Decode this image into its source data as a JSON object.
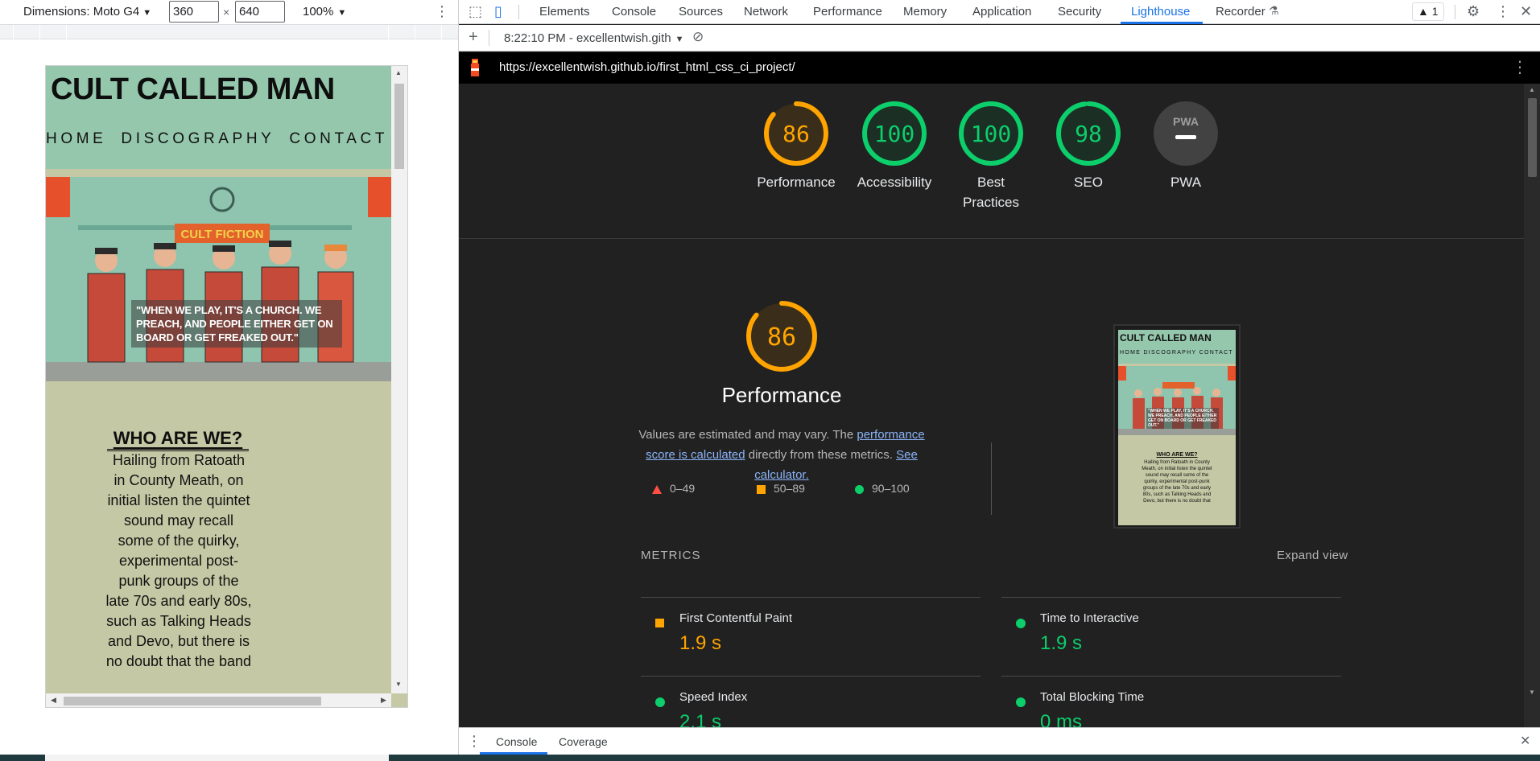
{
  "device_toolbar": {
    "dimensions_label": "Dimensions: Moto G4",
    "width_value": "360",
    "times": "×",
    "height_value": "640",
    "zoom_label": "100%"
  },
  "site": {
    "title": "CULT CALLED MAN",
    "nav": [
      "HOME",
      "DISCOGRAPHY",
      "CONTACT"
    ],
    "hero_quote": "\"WHEN WE PLAY, IT'S A CHURCH. WE PREACH, AND PEOPLE EITHER GET ON BOARD OR GET FREAKED OUT.\"",
    "hero_sign": "CULT FICTION",
    "about_heading": "WHO ARE WE?",
    "about_body": "Hailing from Ratoath in County Meath, on initial listen the quintet sound may recall some of the quirky, experimental post-punk groups of the late 70s and early 80s, such as Talking Heads and Devo, but there is no doubt that the band"
  },
  "devtools": {
    "tabs": [
      "Elements",
      "Console",
      "Sources",
      "Network",
      "Performance",
      "Memory",
      "Application",
      "Security",
      "Lighthouse",
      "Recorder"
    ],
    "active_tab": "Lighthouse",
    "warning_count": "1",
    "report_selector": "8:22:10 PM - excellentwish.gith",
    "url": "https://excellentwish.github.io/first_html_css_ci_project/",
    "drawer_tabs": [
      "Console",
      "Coverage"
    ]
  },
  "colors": {
    "orange": "#ffa400",
    "green": "#0cce6b",
    "red": "#ff4e42",
    "link_blue": "#8ab4f8",
    "devtools_active": "#1a73e8"
  },
  "report": {
    "gauges": [
      {
        "label": "Performance",
        "score": 86,
        "color": "orange"
      },
      {
        "label": "Accessibility",
        "score": 100,
        "color": "green"
      },
      {
        "label": "Best Practices",
        "score": 100,
        "color": "green"
      },
      {
        "label": "SEO",
        "score": 98,
        "color": "green"
      },
      {
        "label": "PWA",
        "score": null,
        "color": "gray"
      }
    ],
    "pwa_badge": "PWA",
    "performance_score": "86",
    "performance_title": "Performance",
    "desc_prefix": "Values are estimated and may vary. The ",
    "desc_link1": "performance score is calculated",
    "desc_middle": " directly from these metrics. ",
    "desc_link2": "See calculator.",
    "legend": [
      "0–49",
      "50–89",
      "90–100"
    ],
    "metrics_label": "METRICS",
    "expand_label": "Expand view",
    "metrics": [
      {
        "name": "First Contentful Paint",
        "value": "1.9 s",
        "rating": "orange"
      },
      {
        "name": "Time to Interactive",
        "value": "1.9 s",
        "rating": "green"
      },
      {
        "name": "Speed Index",
        "value": "2.1 s",
        "rating": "green"
      },
      {
        "name": "Total Blocking Time",
        "value": "0 ms",
        "rating": "green"
      }
    ],
    "thumb": {
      "title": "CULT CALLED MAN",
      "nav": "HOME DISCOGRAPHY CONTACT",
      "quote": "\"WHEN WE PLAY, IT'S A CHURCH. WE PREACH, AND PEOPLE EITHER GET ON BOARD OR GET FREAKED OUT.\"",
      "heading": "WHO ARE WE?",
      "body": "Hailing from Ratoath in County Meath, on initial listen the quintet sound may recall some of the quirky, experimental post-punk groups of the late 70s and early 80s, such as Talking Heads and Devo, but there is no doubt that"
    }
  }
}
